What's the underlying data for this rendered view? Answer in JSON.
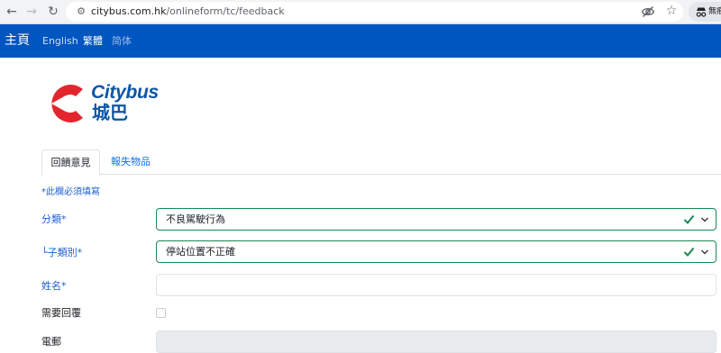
{
  "browser": {
    "url_host": "citybus.com.hk",
    "url_path": "/onlineform/tc/feedback",
    "profile_label": "無痕"
  },
  "navbar": {
    "home": "主頁",
    "languages": {
      "english": "English",
      "traditional": "繁體",
      "simplified": "简体"
    }
  },
  "logo": {
    "name_en": "Citybus",
    "name_zh": "城巴",
    "brand_red": "#e3262d",
    "brand_blue": "#0d56a6"
  },
  "tabs": {
    "feedback": "回饋意見",
    "lost_property": "報失物品"
  },
  "form": {
    "required_note": "*此欄必須填寫",
    "category": {
      "label": "分類*",
      "value": "不良駕駛行為"
    },
    "subcategory": {
      "label": "└子類別*",
      "value": "停站位置不正確"
    },
    "name": {
      "label": "姓名*",
      "value": ""
    },
    "need_reply": {
      "label": "需要回覆"
    },
    "email": {
      "label": "電郵",
      "value": ""
    }
  },
  "colors": {
    "navbar": "#0056c1",
    "link": "#0d6efd",
    "valid": "#198754"
  }
}
